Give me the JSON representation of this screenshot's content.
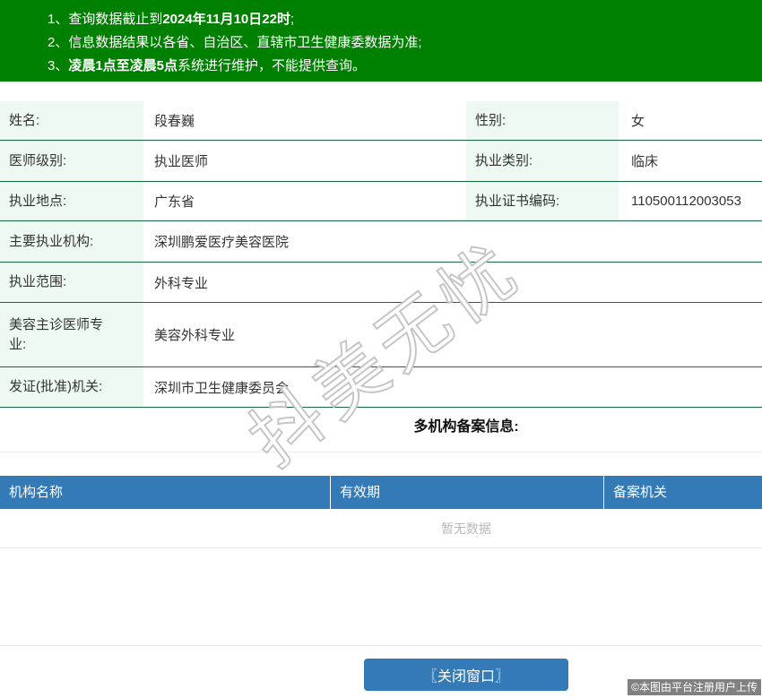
{
  "notice": {
    "lines": [
      {
        "pre": "1、查询数据截止到",
        "bold": "2024年11月10日22时",
        "post": ";"
      },
      {
        "pre": "2、信息数据结果以各省、自治区、直辖市卫生健康委数据为准;",
        "bold": "",
        "post": ""
      },
      {
        "pre": "3、",
        "bold": "凌晨1点至凌晨5点",
        "post": "系统进行维护，不能提供查询。"
      }
    ]
  },
  "profile": {
    "rows_paired": [
      {
        "label": "姓名:",
        "value": "段春巍",
        "label2": "性别:",
        "value2": "女"
      },
      {
        "label": "医师级别:",
        "value": "执业医师",
        "label2": "执业类别:",
        "value2": "临床"
      },
      {
        "label": "执业地点:",
        "value": "广东省",
        "label2": "执业证书编码:",
        "value2": "110500112003053"
      }
    ],
    "rows_full": [
      {
        "label": "主要执业机构:",
        "value": "深圳鹏爱医疗美容医院"
      },
      {
        "label": "执业范围:",
        "value": "外科专业"
      },
      {
        "label": "美容主诊医师专业:",
        "value": "美容外科专业"
      },
      {
        "label": "发证(批准)机关:",
        "value": "深圳市卫生健康委员会"
      }
    ]
  },
  "filing": {
    "title": "多机构备案信息:",
    "columns": [
      "机构名称",
      "有效期",
      "备案机关"
    ],
    "empty_text": "暂无数据"
  },
  "footer": {
    "close_button_label": "〖关闭窗口〗"
  },
  "watermark": {
    "diagonal_text": "抖美无忧",
    "photo_credit": "©本图由平台注册用户上传"
  },
  "colors": {
    "banner_green": "#008000",
    "row_border_green": "#176a3d",
    "label_bg_mint": "#eef9f3",
    "table_header_blue": "#337ab7",
    "button_blue": "#337ab7",
    "empty_text_gray": "#b8b8b8"
  }
}
